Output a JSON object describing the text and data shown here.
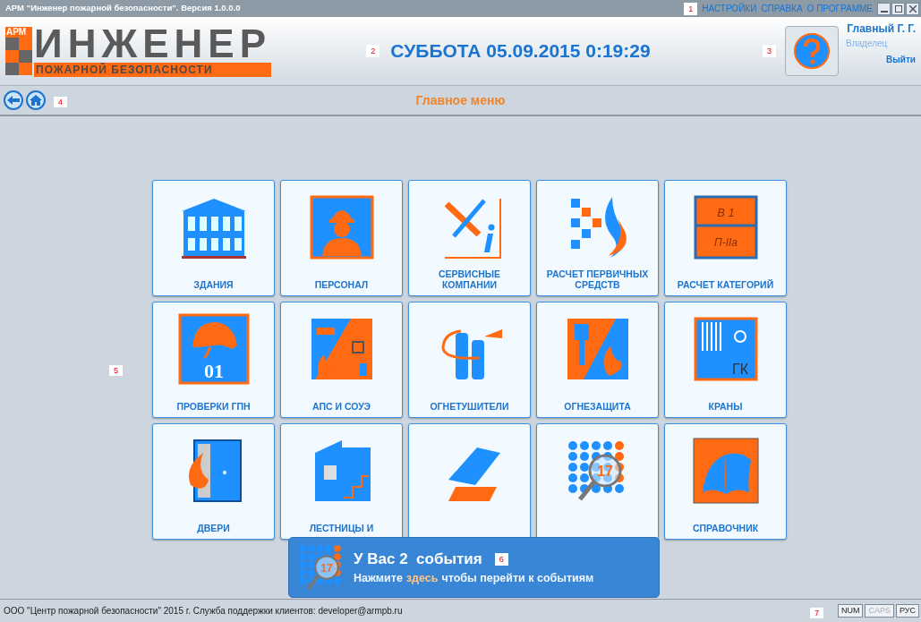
{
  "window": {
    "title": "АРМ \"Инженер пожарной безопасности\". Версия 1.0.0.0",
    "menu": [
      "НАСТРОЙКИ",
      "СПРАВКА",
      "О ПРОГРАММЕ"
    ]
  },
  "callouts": [
    "1",
    "2",
    "3",
    "4",
    "5",
    "6",
    "7"
  ],
  "header": {
    "logo": {
      "badge": "АРМ",
      "title": "ИНЖЕНЕР",
      "subtitle": "ПОЖАРНОЙ БЕЗОПАСНОСТИ"
    },
    "datetime": "СУББОТА 05.09.2015 0:19:29",
    "user": {
      "name": "Главный Г. Г.",
      "role": "Владелец",
      "logout": "Выйти"
    }
  },
  "nav": {
    "title": "Главное меню"
  },
  "tiles": [
    {
      "kind": "building",
      "label": "ЗДАНИЯ"
    },
    {
      "kind": "worker",
      "label": "ПЕРСОНАЛ"
    },
    {
      "kind": "tools",
      "label": "СЕРВИСНЫЕ КОМПАНИИ"
    },
    {
      "kind": "calc",
      "label": "РАСЧЕТ ПЕРВИЧНЫХ СРЕДСТВ"
    },
    {
      "kind": "categories",
      "label": "РАСЧЕТ КАТЕГОРИЙ",
      "icon_text": [
        "В 1",
        "П-IIа"
      ]
    },
    {
      "kind": "helmet",
      "label": "ПРОВЕРКИ ГПН",
      "icon_text": [
        "01"
      ]
    },
    {
      "kind": "alarm",
      "label": "АПС И СОУЭ"
    },
    {
      "kind": "extinguisher",
      "label": "ОГНЕТУШИТЕЛИ"
    },
    {
      "kind": "fireproof",
      "label": "ОГНЕЗАЩИТА"
    },
    {
      "kind": "hydrant",
      "label": "КРАНЫ",
      "icon_text": [
        "ГК"
      ]
    },
    {
      "kind": "door",
      "label": "ДВЕРИ"
    },
    {
      "kind": "stairs",
      "label": "ЛЕСТНИЦЫ И"
    },
    {
      "kind": "roof"
    },
    {
      "kind": "events",
      "icon_text": [
        "17"
      ]
    },
    {
      "kind": "book",
      "label": "СПРАВОЧНИК"
    }
  ],
  "notification": {
    "title": "У Вас 2  события",
    "message_before": "Нажмите",
    "link": "здесь",
    "message_after": "чтобы перейти к событиям",
    "icon_text": "17"
  },
  "status_bar": {
    "text": "ООО \"Центр пожарной безопасности\" 2015 г. Служба поддержки клиентов: developer@armpb.ru",
    "indicators": [
      {
        "label": "NUM",
        "on": true
      },
      {
        "label": "CAPS",
        "on": false
      },
      {
        "label": "РУС",
        "on": true
      }
    ]
  }
}
